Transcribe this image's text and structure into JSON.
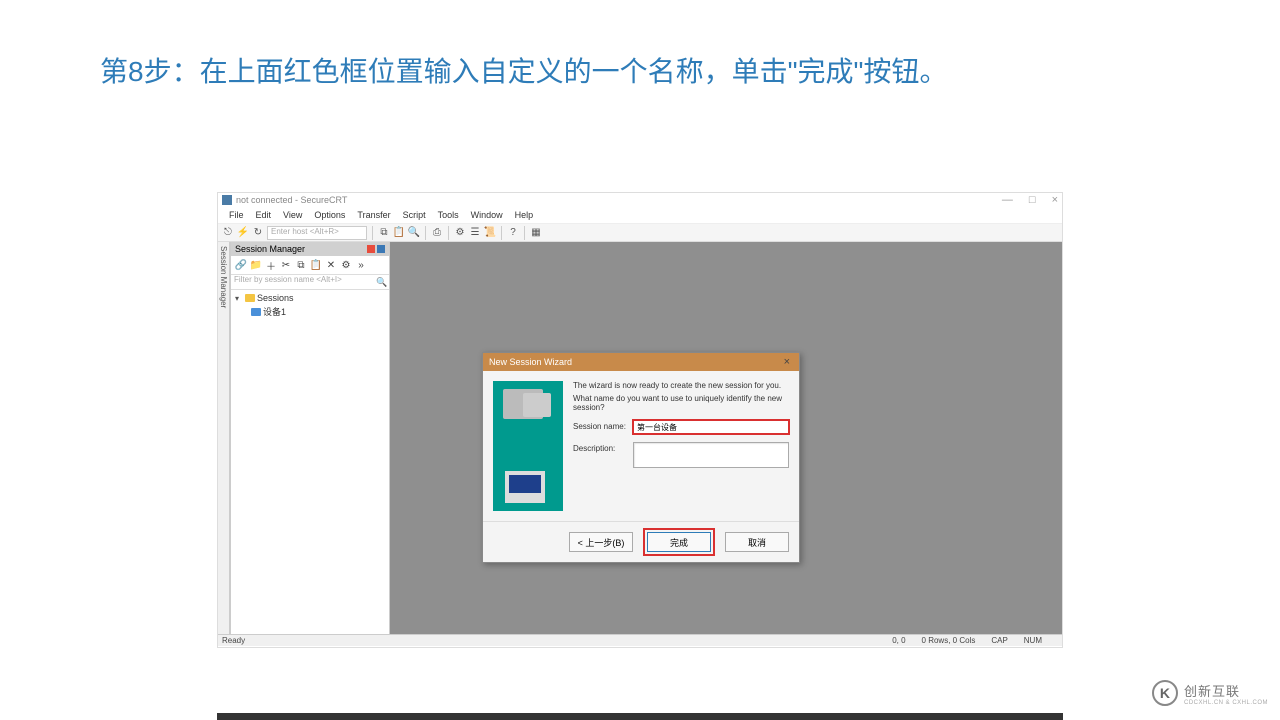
{
  "instruction": "第8步：在上面红色框位置输入自定义的一个名称，单击\"完成\"按钮。",
  "app": {
    "title": "not connected - SecureCRT",
    "window_buttons": {
      "min": "—",
      "max": "□",
      "close": "×"
    }
  },
  "menubar": [
    "File",
    "Edit",
    "View",
    "Options",
    "Transfer",
    "Script",
    "Tools",
    "Window",
    "Help"
  ],
  "toolbar": {
    "host_placeholder": "Enter host <Alt+R>"
  },
  "session_manager": {
    "title": "Session Manager",
    "filter_placeholder": "Filter by session name <Alt+I>",
    "toolbar_icons": [
      "link-icon",
      "new-folder-icon",
      "new-session-icon",
      "cut-icon",
      "copy-icon",
      "paste-icon",
      "delete-icon",
      "settings-icon",
      "more-icon"
    ],
    "tree": {
      "root": "Sessions",
      "children": [
        "设备1"
      ]
    }
  },
  "wizard": {
    "title": "New Session Wizard",
    "text1": "The wizard is now ready to create the new session for you.",
    "text2": "What name do you want to use to uniquely identify the new session?",
    "session_name_label": "Session name:",
    "session_name_value": "第一台设备",
    "description_label": "Description:",
    "description_value": "",
    "buttons": {
      "back": "< 上一步(B)",
      "finish": "完成",
      "cancel": "取消"
    }
  },
  "statusbar": {
    "ready": "Ready",
    "pos": "0, 0",
    "rows": "0 Rows, 0 Cols",
    "caps": "CAP",
    "num": "NUM"
  },
  "watermark": {
    "brand": "创新互联",
    "sub": "CDCXHL.CN & CXHL.COM"
  }
}
